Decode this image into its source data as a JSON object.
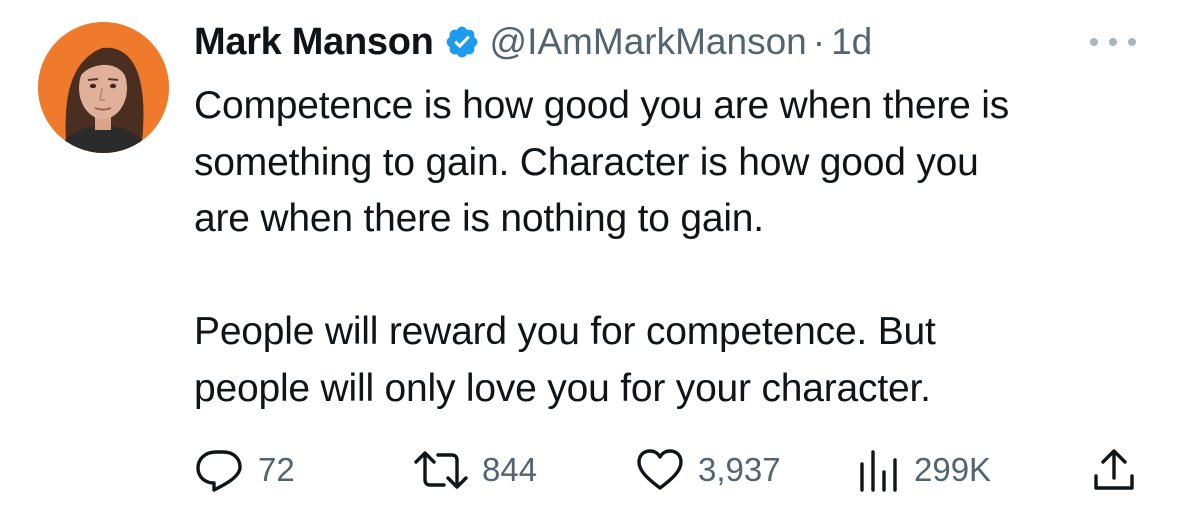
{
  "author": {
    "name": "Mark Manson",
    "handle": "@IAmMarkManson",
    "separator": "·",
    "time": "1d"
  },
  "tweet": {
    "line1": "Competence is how good you are when there is",
    "line2": "something to gain. Character is how good you",
    "line3": "are when there is nothing to gain.",
    "line4": "People will reward you for competence. But",
    "line5": "people will only love you for your character."
  },
  "stats": {
    "replies": "72",
    "retweets": "844",
    "likes": "3,937",
    "views": "299K"
  },
  "icons": {
    "verified": "verified-badge-icon",
    "more": "more-icon",
    "reply": "reply-icon",
    "retweet": "retweet-icon",
    "like": "like-icon",
    "views": "views-icon",
    "share": "share-icon"
  },
  "colors": {
    "verified": "#1d9bf0",
    "muted": "#536471",
    "text": "#0f1419",
    "avatar_bg": "#f07a2c"
  }
}
